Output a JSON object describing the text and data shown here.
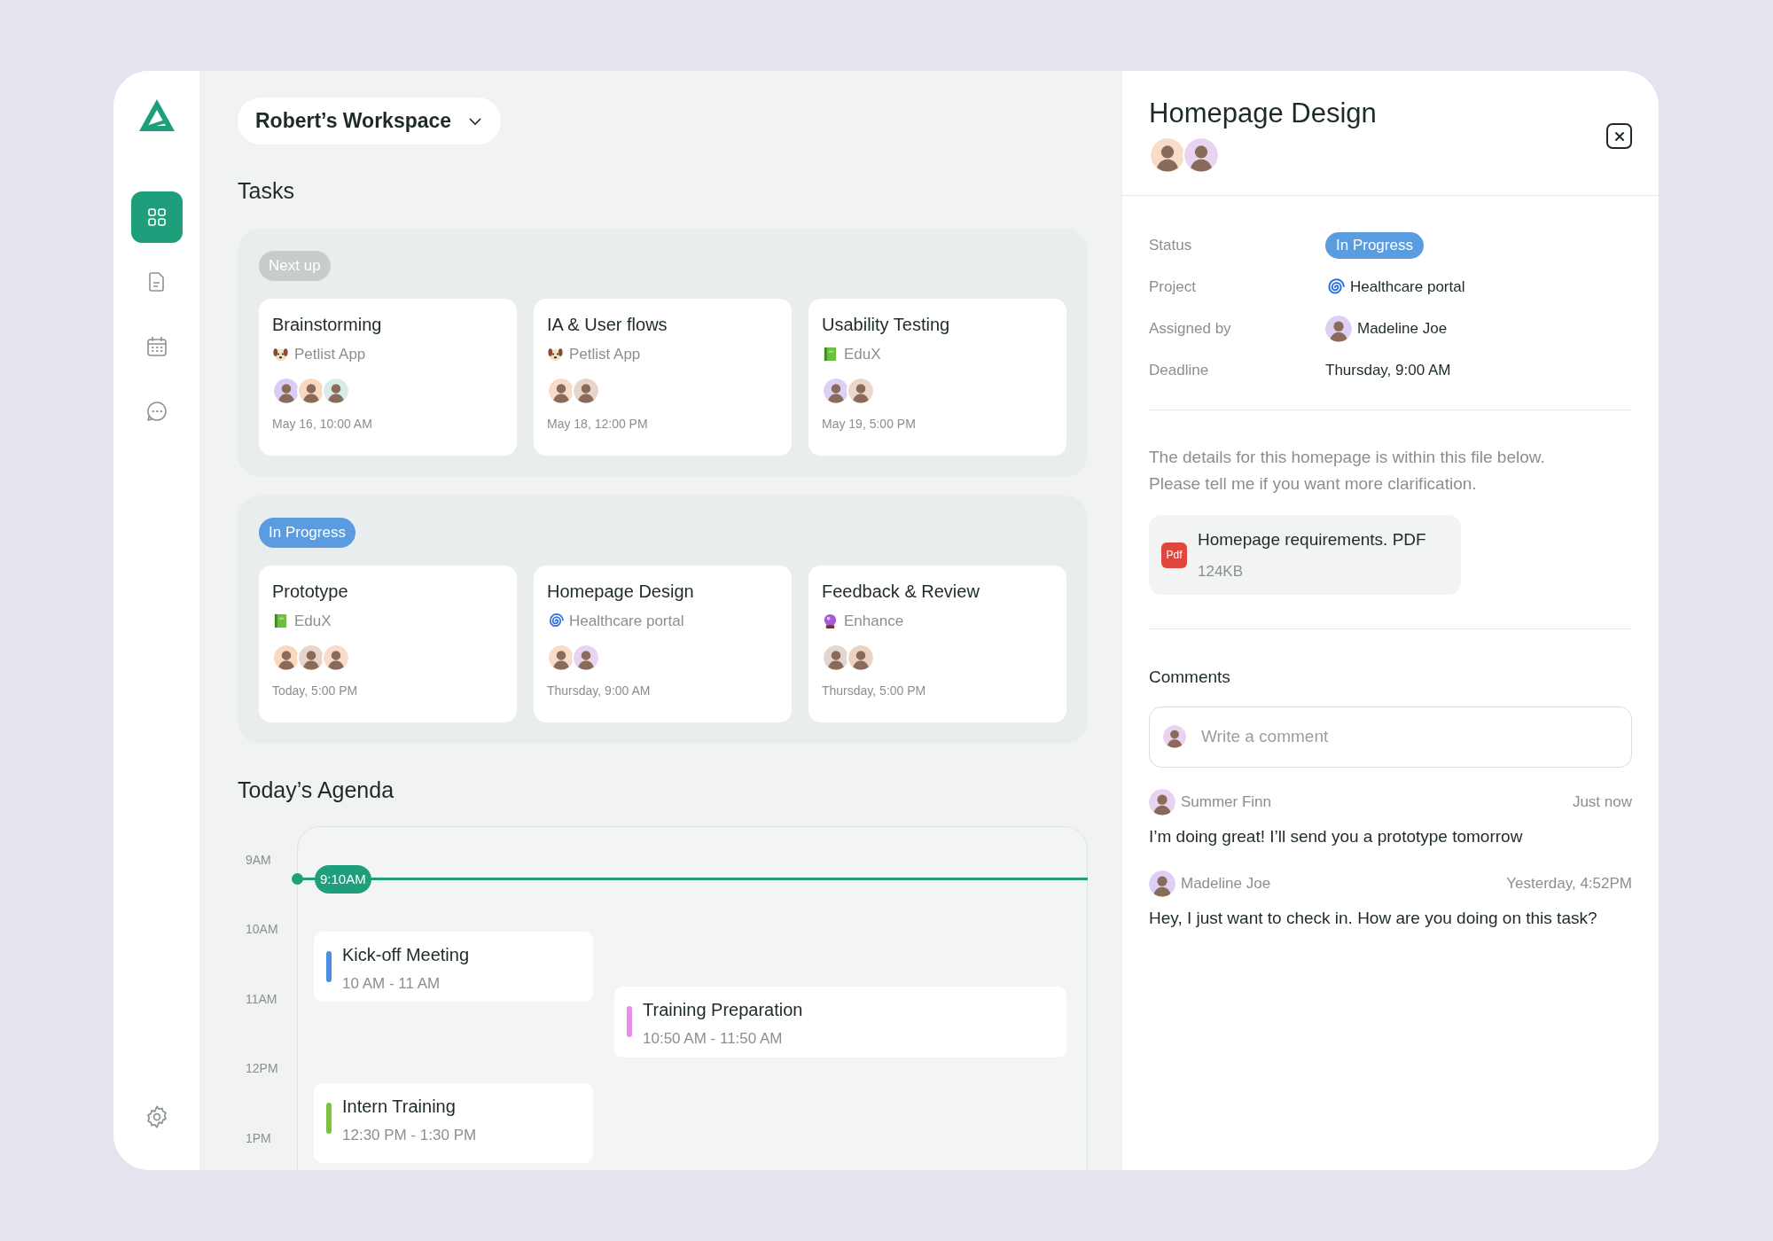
{
  "sidebar": {
    "nav": [
      {
        "kind": "grid",
        "selected": true
      },
      {
        "kind": "document",
        "selected": false
      },
      {
        "kind": "calendar",
        "selected": false
      },
      {
        "kind": "chat",
        "selected": false
      }
    ]
  },
  "workspace": {
    "name": "Robert’s Workspace"
  },
  "tasks": {
    "title": "Tasks",
    "groups": [
      {
        "label": "Next up",
        "kind": "next",
        "cards": [
          {
            "title": "Brainstorming",
            "project": {
              "name": "Petlist App",
              "kind": "dog"
            },
            "members": [
              {
                "color": "#d9cdf5"
              },
              {
                "color": "#f8d9c0"
              },
              {
                "color": "#d7ece8"
              }
            ],
            "due": "May 16, 10:00 AM"
          },
          {
            "title": "IA & User flows",
            "project": {
              "name": "Petlist App",
              "kind": "dog"
            },
            "members": [
              {
                "color": "#f8dcc8"
              },
              {
                "color": "#e6d5cc"
              }
            ],
            "due": "May 18, 12:00 PM"
          },
          {
            "title": "Usability Testing",
            "project": {
              "name": "EduX",
              "kind": "book"
            },
            "members": [
              {
                "color": "#dcd0f5"
              },
              {
                "color": "#ecd6cc"
              }
            ],
            "due": "May 19, 5:00 PM"
          }
        ]
      },
      {
        "label": "In Progress",
        "kind": "progress",
        "cards": [
          {
            "title": "Prototype",
            "project": {
              "name": "EduX",
              "kind": "book"
            },
            "members": [
              {
                "color": "#f8d9c0"
              },
              {
                "color": "#e6d5cc"
              },
              {
                "color": "#f8dcc8"
              }
            ],
            "due": "Today, 5:00 PM"
          },
          {
            "title": "Homepage Design",
            "project": {
              "name": "Healthcare portal",
              "kind": "spiral"
            },
            "members": [
              {
                "color": "#f8dcc8"
              },
              {
                "color": "#e8d4f0"
              }
            ],
            "due": "Thursday, 9:00 AM"
          },
          {
            "title": "Feedback & Review",
            "project": {
              "name": "Enhance",
              "kind": "orb"
            },
            "members": [
              {
                "color": "#e0d8d0"
              },
              {
                "color": "#ecd2c0"
              }
            ],
            "due": "Thursday, 5:00 PM"
          }
        ]
      }
    ]
  },
  "agenda": {
    "title": "Today’s Agenda",
    "hours": [
      "9AM",
      "10AM",
      "11AM",
      "12PM",
      "1PM"
    ],
    "now": "9:10AM",
    "events": [
      {
        "title": "Kick-off Meeting",
        "time": "10 AM - 11 AM",
        "color": "#4a90e2"
      },
      {
        "title": "Training Preparation",
        "time": "10:50 AM - 11:50 AM",
        "color": "#e88ee8"
      },
      {
        "title": "Intern Training",
        "time": "12:30 PM - 1:30 PM",
        "color": "#7cc242"
      }
    ]
  },
  "detail": {
    "title": "Homepage Design",
    "members": [
      {
        "color": "#f8dcc8"
      },
      {
        "color": "#e8d4f0"
      }
    ],
    "fields": [
      {
        "label": "Status",
        "kind": "badge",
        "value": "In Progress"
      },
      {
        "label": "Project",
        "kind": "project",
        "project": {
          "name": "Healthcare portal",
          "kind": "spiral"
        }
      },
      {
        "label": "Assigned by",
        "kind": "person",
        "value": "Madeline Joe",
        "color": "#ddd0f5"
      },
      {
        "label": "Deadline",
        "kind": "text",
        "value": "Thursday, 9:00 AM"
      }
    ],
    "description": "The details for this homepage is within this file below. Please tell me if you want more clarification.",
    "file": {
      "name": "Homepage requirements. PDF",
      "size": "124KB",
      "type_label": "Pdf"
    },
    "comments_title": "Comments",
    "comment_input": {
      "placeholder": "Write a comment",
      "avatar": {
        "color": "#e8d4f0"
      }
    },
    "comments": [
      {
        "author": "Summer Finn",
        "time": "Just now",
        "text": "I’m doing great! I’ll send you a prototype tomorrow",
        "color": "#e8d4f0"
      },
      {
        "author": "Madeline Joe",
        "time": "Yesterday, 4:52PM",
        "text": "Hey, I just want to check in. How are you doing on this task?",
        "color": "#ddd0f5"
      }
    ]
  }
}
